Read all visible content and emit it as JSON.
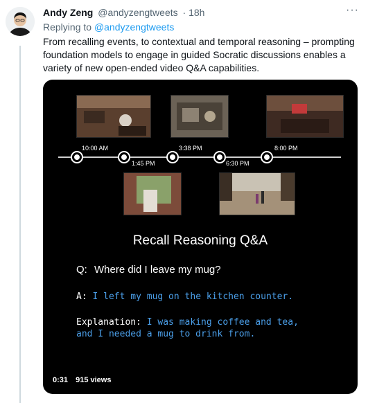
{
  "tweet": {
    "author_name": "Andy Zeng",
    "author_handle": "@andyzengtweets",
    "separator": "·",
    "time": "18h",
    "more_label": "···",
    "replying_prefix": "Replying to",
    "replying_to": "@andyzengtweets",
    "text": "From recalling events, to contextual and temporal reasoning – prompting foundation models to engage in guided Socratic discussions enables a variety of new open-ended video Q&A capabilities."
  },
  "video": {
    "timeline_labels": [
      "10:00 AM",
      "1:45 PM",
      "3:38 PM",
      "6:30 PM",
      "8:00 PM"
    ],
    "title": "Recall Reasoning Q&A",
    "question_prefix": "Q:",
    "question": "Where did I leave my mug?",
    "answer_prefix": "A:",
    "answer": "I left my mug on the kitchen counter.",
    "explanation_prefix": "Explanation:",
    "explanation_line1": "I was making coffee and tea,",
    "explanation_line2": "and I needed a mug to drink from.",
    "duration": "0:31",
    "views": "915 views"
  },
  "colors": {
    "link": "#1d9bf0",
    "answer_text": "#4b9fe9",
    "secondary_text": "#536471",
    "thread_line": "#cfd9de"
  }
}
